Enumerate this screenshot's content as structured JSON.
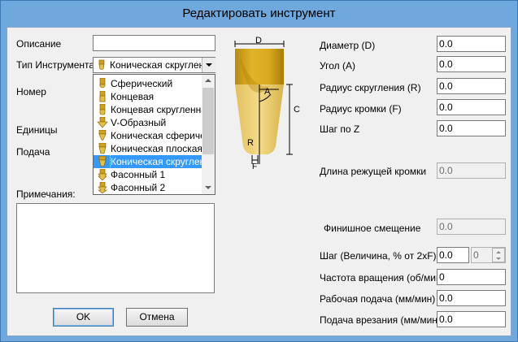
{
  "window": {
    "title": "Редактировать инструмент"
  },
  "left": {
    "description_label": "Описание",
    "description_value": "",
    "tool_type_label": "Тип Инструмента",
    "tool_type_selected": "Коническая скругленн",
    "number_label": "Номер",
    "units_label": "Единицы",
    "feed_label": "Подача",
    "notes_label": "Примечания:",
    "notes_value": ""
  },
  "dropdown": {
    "items": [
      {
        "label": "Сферический",
        "icon": "ball-mill-icon"
      },
      {
        "label": "Концевая",
        "icon": "end-mill-icon"
      },
      {
        "label": "Концевая скругленная",
        "icon": "bull-nose-mill-icon"
      },
      {
        "label": "V-Образный",
        "icon": "v-bit-icon"
      },
      {
        "label": "Коническая сферичес",
        "icon": "tapered-ball-icon"
      },
      {
        "label": "Коническая плоская",
        "icon": "tapered-flat-icon"
      },
      {
        "label": "Коническая скругленн",
        "icon": "tapered-radius-icon",
        "selected": true
      },
      {
        "label": "Фасонный 1",
        "icon": "form-tool-1-icon"
      },
      {
        "label": "Фасонный 2",
        "icon": "form-tool-2-icon"
      }
    ]
  },
  "diagram": {
    "label_d": "D",
    "label_a": "A",
    "label_c": "C",
    "label_r": "R",
    "label_f": "F"
  },
  "right": {
    "diameter_label": "Диаметр (D)",
    "diameter_value": "0.0",
    "angle_label": "Угол (A)",
    "angle_value": "0.0",
    "radius_label": "Радиус скругления (R)",
    "radius_value": "0.0",
    "edge_radius_label": "Радиус кромки (F)",
    "edge_radius_value": "0.0",
    "z_step_label": "Шаг по Z",
    "z_step_value": "0.0",
    "cut_length_label": "Длина режущей кромки",
    "cut_length_value": "0.0",
    "finish_offset_label": "Финишное смещение",
    "finish_offset_value": "0.0",
    "step_label": "Шаг (Величина, % от 2xF)",
    "step_value": "0.0",
    "step_percent": "0",
    "spindle_label": "Частота вращения (об/мин)",
    "spindle_value": "0",
    "feed_rate_label": "Рабочая подача (мм/мин)",
    "feed_rate_value": "0.0",
    "plunge_label": "Подача врезания (мм/мин)",
    "plunge_value": "0.0"
  },
  "buttons": {
    "ok": "OK",
    "cancel": "Отмена"
  },
  "colors": {
    "gold": "#d4a017",
    "selection": "#3399ff",
    "frame": "#6ea8dc"
  }
}
